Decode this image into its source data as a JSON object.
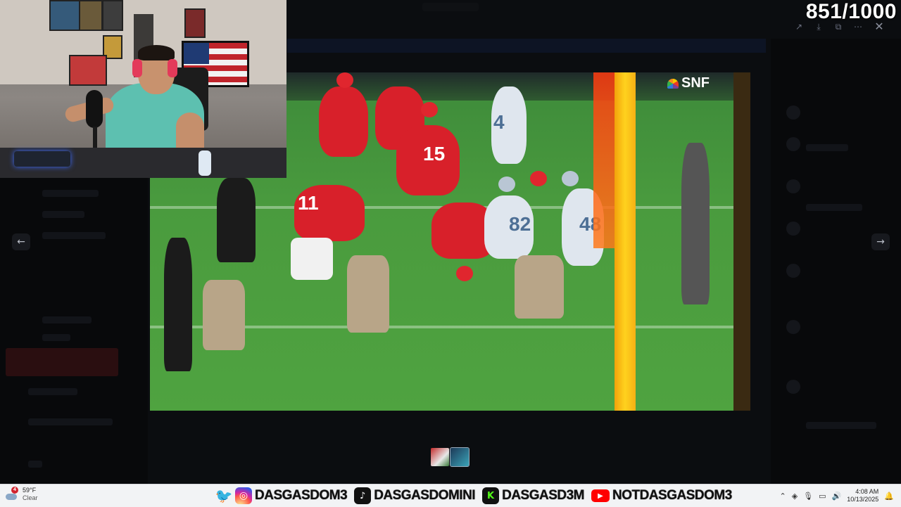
{
  "counter": "851/1000",
  "viewer": {
    "controls": [
      "share-icon",
      "download-icon",
      "open-external-icon",
      "more-icon"
    ],
    "close_icon": "close-icon",
    "prev_icon": "arrow-left-icon",
    "next_icon": "arrow-right-icon",
    "prev_glyph": "←",
    "next_glyph": "→",
    "close_glyph": "✕"
  },
  "video": {
    "broadcast_logo": "SNF",
    "jersey_numbers": [
      "11",
      "15",
      "4",
      "48",
      "82"
    ]
  },
  "thumbnails": [
    "thumb-1",
    "thumb-2"
  ],
  "taskbar": {
    "weather": {
      "badge": "4",
      "temp": "59°F",
      "condition": "Clear"
    },
    "socials": [
      {
        "icon": "twitter-icon",
        "handle": ""
      },
      {
        "icon": "instagram-icon",
        "handle": "DASGASDOM3"
      },
      {
        "icon": "tiktok-icon",
        "handle": "DASGASDOMINI"
      },
      {
        "icon": "kick-icon",
        "handle": "DASGASD3M"
      },
      {
        "icon": "youtube-icon",
        "handle": "NOTDASGASDOM3"
      }
    ],
    "clock": {
      "time": "4:08 AM",
      "date": "10/13/2025"
    }
  }
}
